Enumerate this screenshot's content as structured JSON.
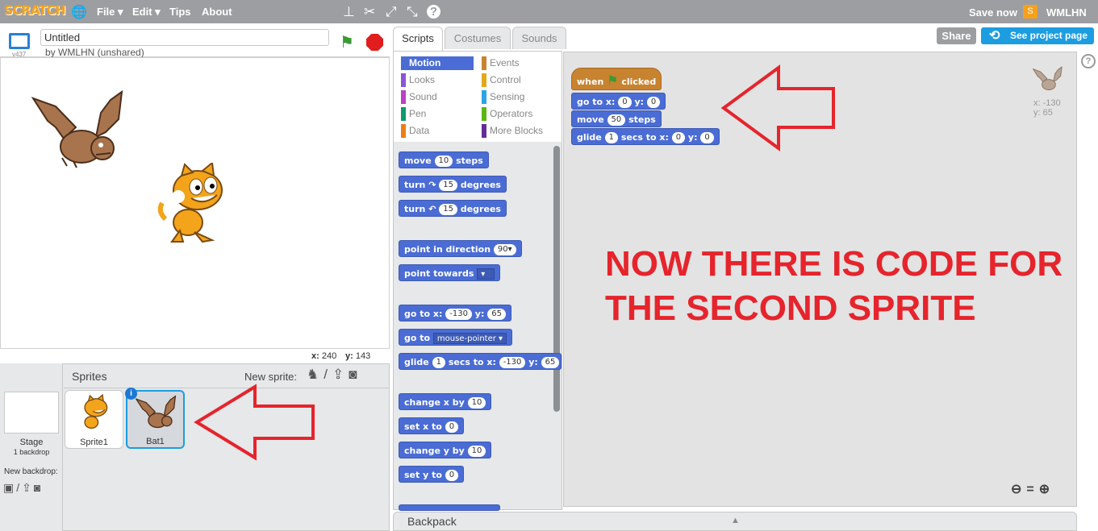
{
  "menubar": {
    "logo": "SCRATCH",
    "menus": [
      "File ▾",
      "Edit ▾",
      "Tips",
      "About"
    ],
    "save_now": "Save now",
    "user_initial": "S",
    "username": "WMLHN"
  },
  "stage_header": {
    "version": "v437",
    "project_title": "Untitled",
    "byline": "by WMLHN (unshared)"
  },
  "stage_coords": {
    "x_label": "x:",
    "x": "240",
    "y_label": "y:",
    "y": "143"
  },
  "sprites_pane": {
    "title": "Sprites",
    "new_sprite": "New sprite:",
    "stage_label": "Stage",
    "stage_sub": "1 backdrop",
    "new_backdrop": "New backdrop:",
    "sprites": [
      {
        "name": "Sprite1",
        "selected": false
      },
      {
        "name": "Bat1",
        "selected": true
      }
    ]
  },
  "tabs": [
    "Scripts",
    "Costumes",
    "Sounds"
  ],
  "share_button": "Share",
  "project_page_button": "See project page",
  "categories": [
    {
      "label": "Motion",
      "color": "#4a6cd4",
      "selected": true
    },
    {
      "label": "Events",
      "color": "#c88330"
    },
    {
      "label": "Looks",
      "color": "#8a55d7"
    },
    {
      "label": "Control",
      "color": "#e1a91a"
    },
    {
      "label": "Sound",
      "color": "#bb42c3"
    },
    {
      "label": "Sensing",
      "color": "#2ca5e2"
    },
    {
      "label": "Pen",
      "color": "#0e9a6c"
    },
    {
      "label": "Operators",
      "color": "#5cb712"
    },
    {
      "label": "Data",
      "color": "#ee7d16"
    },
    {
      "label": "More Blocks",
      "color": "#632d99"
    }
  ],
  "palette_blocks": {
    "move": {
      "pre": "move",
      "val": "10",
      "post": "steps"
    },
    "turn_cw": {
      "pre": "turn",
      "icon": "↷",
      "val": "15",
      "post": "degrees"
    },
    "turn_ccw": {
      "pre": "turn",
      "icon": "↶",
      "val": "15",
      "post": "degrees"
    },
    "point_dir": {
      "pre": "point in direction",
      "val": "90▾"
    },
    "point_towards": {
      "pre": "point towards",
      "dd": "▾"
    },
    "goto_xy": {
      "pre": "go to x:",
      "x": "-130",
      "mid": "y:",
      "y": "65"
    },
    "goto": {
      "pre": "go to",
      "dd": "mouse-pointer ▾"
    },
    "glide": {
      "pre": "glide",
      "secs": "1",
      "mid1": "secs to x:",
      "x": "-130",
      "mid2": "y:",
      "y": "65"
    },
    "change_x": {
      "pre": "change x by",
      "val": "10"
    },
    "set_x": {
      "pre": "set x to",
      "val": "0"
    },
    "change_y": {
      "pre": "change y by",
      "val": "10"
    },
    "set_y": {
      "pre": "set y to",
      "val": "0"
    }
  },
  "script_blocks": {
    "hat": {
      "pre": "when",
      "post": "clicked"
    },
    "goto": {
      "pre": "go to x:",
      "x": "0",
      "mid": "y:",
      "y": "0"
    },
    "move": {
      "pre": "move",
      "val": "50",
      "post": "steps"
    },
    "glide": {
      "pre": "glide",
      "secs": "1",
      "mid1": "secs to x:",
      "x": "0",
      "mid2": "y:",
      "y": "0"
    }
  },
  "sprite_info": {
    "x": "x: -130",
    "y": "y: 65"
  },
  "annotation": {
    "line1": "NOW THERE IS CODE FOR",
    "line2": "THE SECOND SPRITE",
    "color": "#e6242c"
  },
  "backpack": "Backpack",
  "colors": {
    "motion": "#4a6cd4",
    "events": "#c88330",
    "accent": "#1c9de0",
    "topbar": "#9c9ea2"
  }
}
